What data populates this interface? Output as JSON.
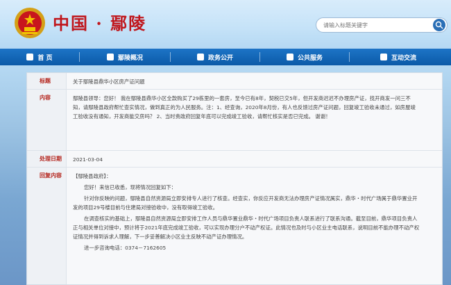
{
  "header": {
    "site_title": "中国 · 鄢陵",
    "search_placeholder": "请输入标题关键字"
  },
  "nav": {
    "items": [
      {
        "label": "首    页"
      },
      {
        "label": "鄢陵概况"
      },
      {
        "label": "政务公开"
      },
      {
        "label": "公共服务"
      },
      {
        "label": "互动交流"
      }
    ]
  },
  "detail": {
    "title_label": "标题",
    "title_value": "关于鄢陵县鼎华小区房产证问题",
    "content_label": "内容",
    "content_value": "鄢陵县领导：您好！ 我在鄢陵县鼎华小区全款购买了29栋里的一套房，至今已有8年，契税已交5年，但开发商迟迟不办理房产证，找开商发一问三不知，请鄢陵县政府帮忙查实情况，做到真正的为人民服务。注：1、经查询，2020年8月份，有人也反馈过房产证问题，回复竣工验收未通过，如房屋竣工验收没有通知，开发商能交房吗？ 2、当时责政府回复年底可以完成竣工验收，请帮忙核实是否已完成。 谢谢！",
    "date_label": "处理日期",
    "date_value": "2021-03-04",
    "reply_label": "回复内容",
    "reply": {
      "org": "【鄢陵县政府】：",
      "p1": "您好！来信已收悉，现将情况回复如下：",
      "p2": "针对你反映的问题，鄢陵县自然资源局立即安排专人进行了核查。经查实，你反应开发商无法办理房产证情况属实，鼎华・时代广场属于鼎华置业开发的项目29号楼目前与住建局对接验收中，没有取得竣工验收。",
      "p3": "在调查核实的基础上，鄢陵县自然资源局立即安排工作人员与鼎华置业鼎华・时代广场项目负责人联系进行了联系沟通。截至目前，鼎华项目负责人正与相关单位对接中，预计将于2021年底完成竣工验收，可以实现办理分户不动产权证。此情况也及时与小区业主电话联系，说明目前不能办理不动产权证情况并得到诉求人理解，下一步妥善解决小区业主反映不动产证办理情况。",
      "p4": "进一步咨询电话：0374－7162605"
    }
  }
}
